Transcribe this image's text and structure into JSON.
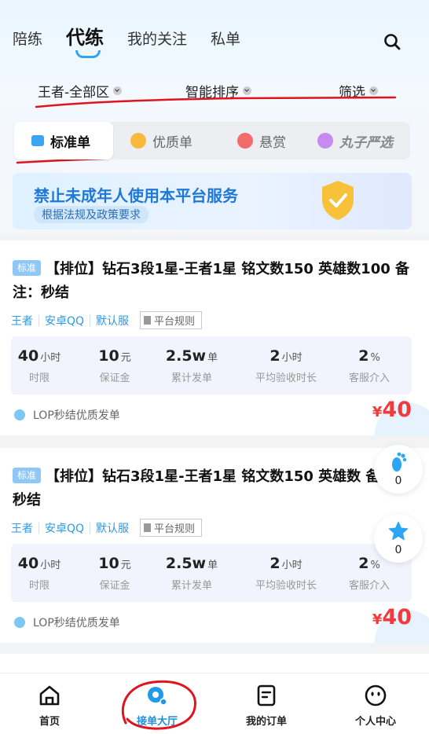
{
  "tabs": [
    "陪练",
    "代练",
    "我的关注",
    "私单"
  ],
  "filters": {
    "region": "王者-全部区",
    "sort": "智能排序",
    "filter": "筛选"
  },
  "segments": [
    "标准单",
    "优质单",
    "悬赏",
    "丸子严选"
  ],
  "banner": {
    "line1": "禁止未成年人使用本平台服务",
    "line2": "根据法规及政策要求"
  },
  "orders": [
    {
      "badge": "标准",
      "title": "【排位】钻石3段1星-王者1星 铭文数150 英雄数100 备注：秒结",
      "meta": [
        "王者",
        "安卓QQ",
        "默认服"
      ],
      "rule": "平台规则",
      "stats": [
        {
          "value": "40",
          "unit": "小时",
          "label": "时限"
        },
        {
          "value": "10",
          "unit": "元",
          "label": "保证金"
        },
        {
          "value": "2.5w",
          "unit": "单",
          "label": "累计发单"
        },
        {
          "value": "2",
          "unit": "小时",
          "label": "平均验收时长"
        },
        {
          "value": "2",
          "unit": "%",
          "label": "客服介入"
        }
      ],
      "issuer": "LOP秒结优质发单",
      "price_currency": "¥",
      "price": "40"
    },
    {
      "badge": "标准",
      "title": "【排位】钻石3段1星-王者1星 铭文数150 英雄数 备注：秒结",
      "meta": [
        "王者",
        "安卓QQ",
        "默认服"
      ],
      "rule": "平台规则",
      "stats": [
        {
          "value": "40",
          "unit": "小时",
          "label": "时限"
        },
        {
          "value": "10",
          "unit": "元",
          "label": "保证金"
        },
        {
          "value": "2.5w",
          "unit": "单",
          "label": "累计发单"
        },
        {
          "value": "2",
          "unit": "小时",
          "label": "平均验收时长"
        },
        {
          "value": "2",
          "unit": "%",
          "label": "客服介入"
        }
      ],
      "issuer": "LOP秒结优质发单",
      "price_currency": "¥",
      "price": "40"
    }
  ],
  "fab": {
    "footprint_count": "0",
    "star_count": "0"
  },
  "nav": [
    "首页",
    "接单大厅",
    "我的订单",
    "个人中心"
  ],
  "colors": {
    "accent": "#2aa6f5",
    "price": "#f23a3a"
  }
}
